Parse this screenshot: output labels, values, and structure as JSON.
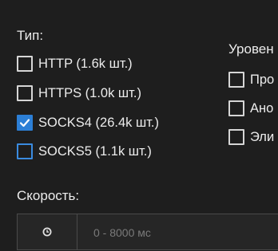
{
  "type_section": {
    "title": "Тип:",
    "options": [
      {
        "label": "HTTP (1.6k шт.)",
        "checked": false
      },
      {
        "label": "HTTPS (1.0k шт.)",
        "checked": false
      },
      {
        "label": "SOCKS4 (26.4k шт.)",
        "checked": true
      },
      {
        "label": "SOCKS5 (1.1k шт.)",
        "checked": false
      }
    ]
  },
  "level_section": {
    "title": "Уровен",
    "options": [
      {
        "label": "Про",
        "checked": false
      },
      {
        "label": "Ано",
        "checked": false
      },
      {
        "label": "Эли",
        "checked": false
      }
    ]
  },
  "speed_section": {
    "title": "Скорость:",
    "icon": "clock-icon",
    "placeholder": "0 - 8000 мс",
    "value": ""
  },
  "colors": {
    "background": "#1e1e1e",
    "accent": "#2c7fd6",
    "border": "#4a4a4a"
  }
}
